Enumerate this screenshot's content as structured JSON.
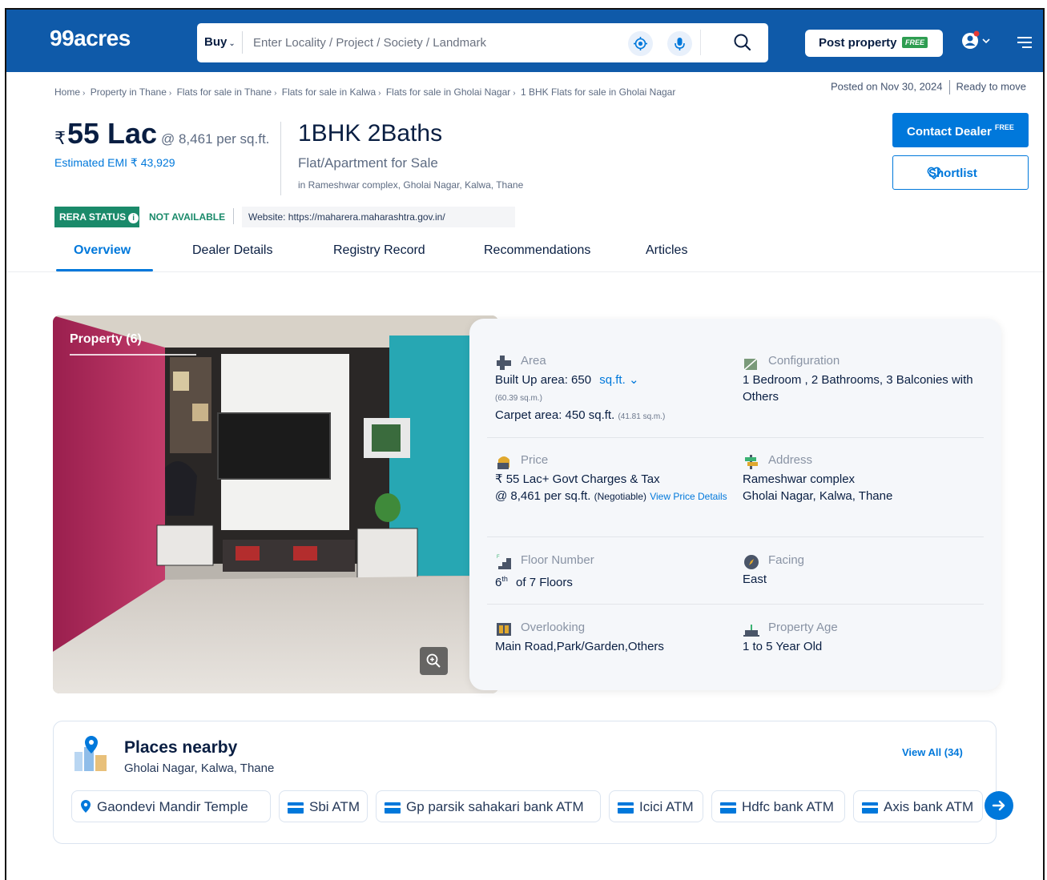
{
  "header": {
    "logo": "99acres",
    "search": {
      "type_label": "Buy",
      "placeholder": "Enter Locality / Project / Society / Landmark"
    },
    "post_property_label": "Post property",
    "post_property_tag": "FREE"
  },
  "breadcrumb": [
    "Home",
    "Property in Thane",
    "Flats for sale in Thane",
    "Flats for sale in Kalwa",
    "Flats for sale in Gholai Nagar",
    "1 BHK Flats for sale in Gholai Nagar"
  ],
  "meta": {
    "posted": "Posted on Nov 30, 2024",
    "status": "Ready to move"
  },
  "listing": {
    "rupee": "₹",
    "price": "55 Lac",
    "price_per_sqft": "@ 8,461 per sq.ft.",
    "emi": "Estimated EMI ₹ 43,929",
    "title": "1BHK 2Baths",
    "subtitle": "Flat/Apartment for Sale",
    "location": "in Rameshwar complex, Gholai Nagar, Kalwa, Thane"
  },
  "actions": {
    "contact_label": "Contact Dealer",
    "contact_tag": "FREE",
    "shortlist_label": "Shortlist"
  },
  "rera": {
    "badge": "RERA STATUS",
    "status": "NOT AVAILABLE",
    "website": "Website: https://maharera.maharashtra.gov.in/"
  },
  "tabs": [
    "Overview",
    "Dealer Details",
    "Registry Record",
    "Recommendations",
    "Articles"
  ],
  "photo": {
    "label": "Property (6)"
  },
  "details": {
    "area": {
      "label": "Area",
      "builtup": "Built Up area: 650",
      "unit": "sq.ft.",
      "builtup_sqm": "(60.39 sq.m.)",
      "carpet": "Carpet area: 450 sq.ft.",
      "carpet_sqm": "(41.81 sq.m.)"
    },
    "configuration": {
      "label": "Configuration",
      "value": "1 Bedroom , 2 Bathrooms, 3 Balconies with Others"
    },
    "price": {
      "label": "Price",
      "line1": "₹ 55 Lac+ Govt Charges & Tax",
      "line2": "@ 8,461 per sq.ft.",
      "negotiable": "(Negotiable)",
      "link": "View Price Details"
    },
    "address": {
      "label": "Address",
      "line1": "Rameshwar complex",
      "line2": "Gholai Nagar, Kalwa, Thane"
    },
    "floor": {
      "label": "Floor Number",
      "floor": "6",
      "suffix": "th",
      "of": "of 7 Floors"
    },
    "facing": {
      "label": "Facing",
      "value": "East"
    },
    "overlooking": {
      "label": "Overlooking",
      "value": "Main Road,Park/Garden,Others"
    },
    "age": {
      "label": "Property Age",
      "value": "1 to 5 Year Old"
    }
  },
  "places": {
    "title": "Places nearby",
    "subtitle": "Gholai Nagar, Kalwa, Thane",
    "view_all": "View All (34)",
    "chips": [
      "Gaondevi Mandir Temple",
      "Sbi ATM",
      "Gp parsik sahakari bank ATM",
      "Icici ATM",
      "Hdfc bank ATM",
      "Axis bank ATM"
    ]
  },
  "colors": {
    "header": "#0f5aa9",
    "accent": "#0078db",
    "rera": "#1a8a6a"
  }
}
